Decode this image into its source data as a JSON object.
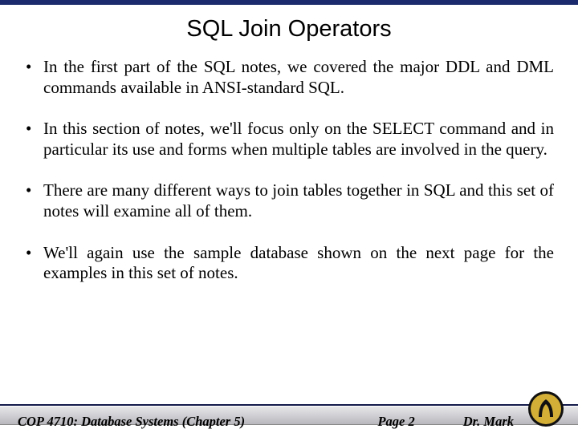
{
  "title": "SQL Join Operators",
  "bullets": [
    "In the first part of the SQL notes, we covered the major DDL and DML commands available in ANSI-standard SQL.",
    "In this section of notes, we'll focus only on the SELECT command and in particular its use and forms when multiple tables are involved in the query.",
    "There are many different ways to join tables together in SQL and this set of notes will examine all of them.",
    "We'll again use the sample database shown on the next page for the examples in this set of notes."
  ],
  "footer": {
    "course": "COP 4710: Database Systems  (Chapter 5)",
    "page": "Page 2",
    "author": "Dr. Mark"
  }
}
